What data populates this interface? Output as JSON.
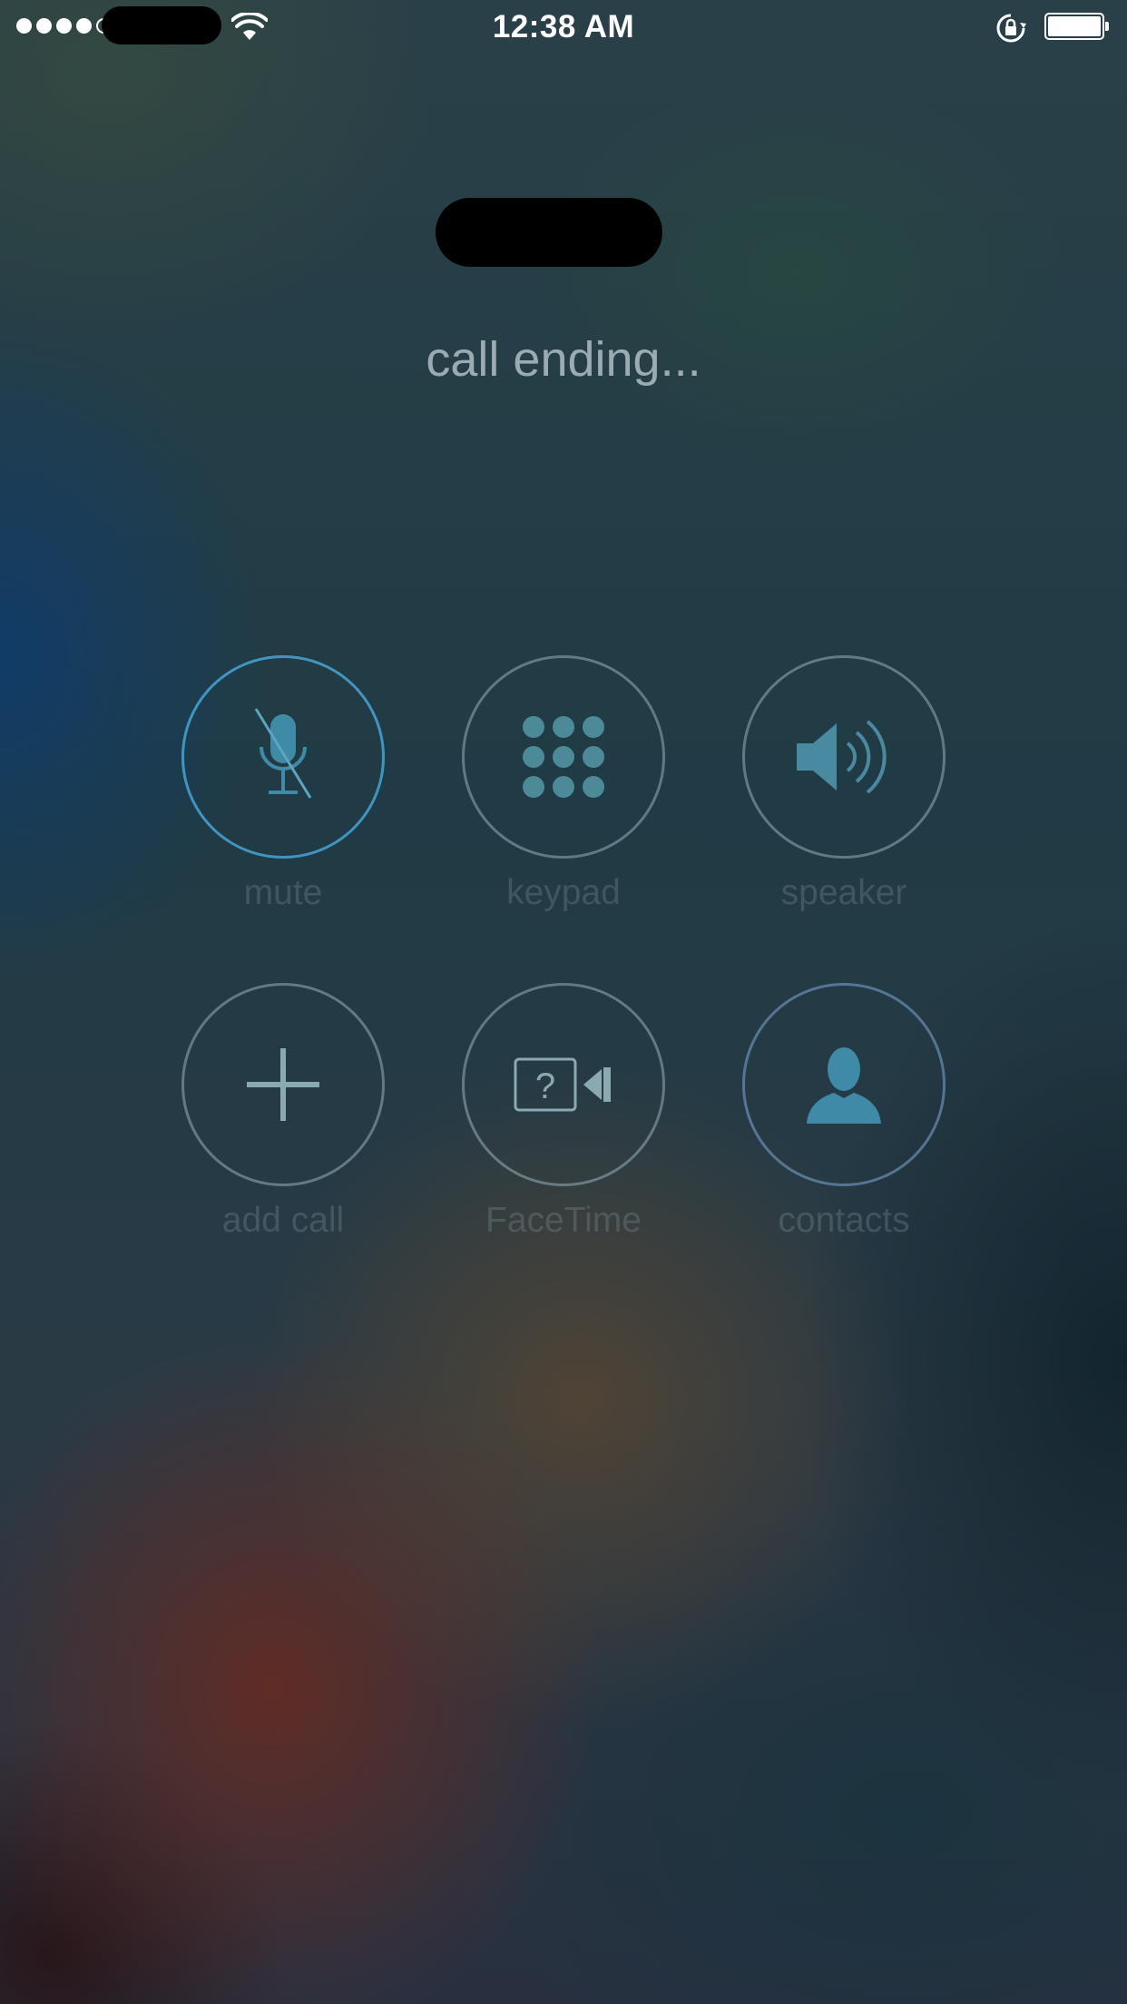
{
  "status_bar": {
    "signal_bars_filled": 4,
    "signal_bars_total": 5,
    "time": "12:38 AM",
    "icons": [
      "signal-dots-icon",
      "wifi-icon",
      "rotation-lock-icon",
      "battery-icon"
    ],
    "battery_level": 1.0
  },
  "call": {
    "status": "call ending..."
  },
  "controls": [
    {
      "label": "mute",
      "icon": "mute-microphone-icon"
    },
    {
      "label": "keypad",
      "icon": "keypad-grid-icon"
    },
    {
      "label": "speaker",
      "icon": "speaker-icon"
    },
    {
      "label": "add call",
      "icon": "plus-icon"
    },
    {
      "label": "FaceTime",
      "icon": "facetime-question-icon"
    },
    {
      "label": "contacts",
      "icon": "contact-silhouette-icon"
    }
  ],
  "colors": {
    "icon_tint": "#4a8aa0",
    "active_ring": "#46a5d7"
  }
}
